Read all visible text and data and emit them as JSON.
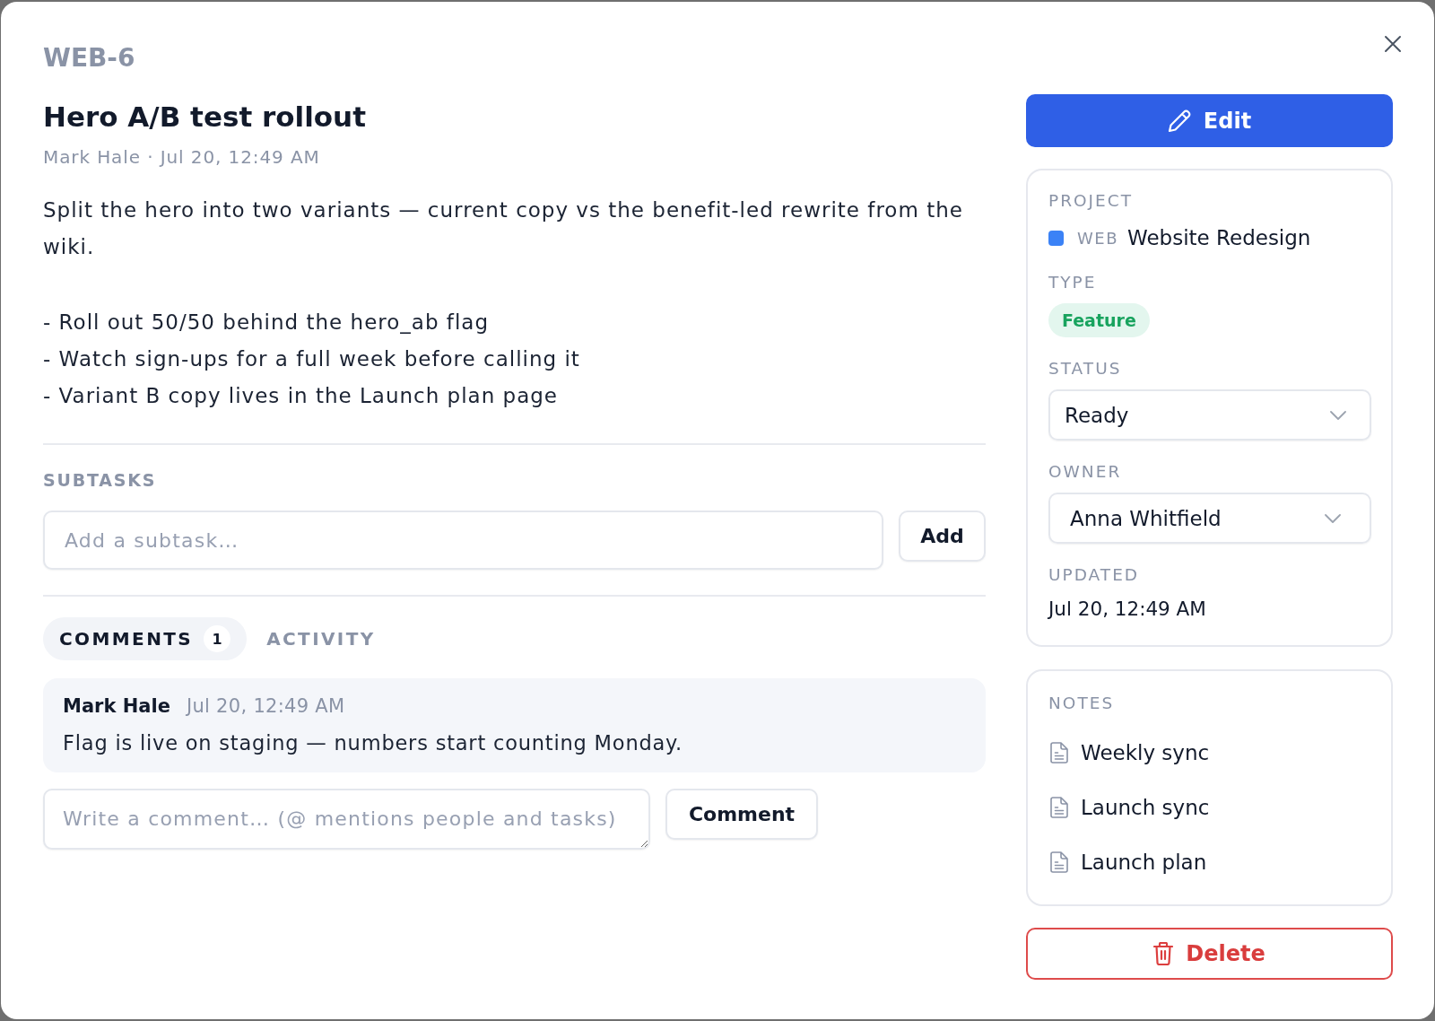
{
  "task": {
    "key": "WEB-6",
    "title": "Hero A/B test rollout",
    "meta": "Mark Hale · Jul 20, 12:49 AM",
    "description": {
      "paragraph": "Split the hero into two variants — current copy vs the benefit-led rewrite from the wiki.",
      "bullets": [
        "- Roll out 50/50 behind the hero_ab flag",
        "- Watch sign-ups for a full week before calling it",
        "- Variant B copy lives in the Launch plan page"
      ]
    }
  },
  "subtasks": {
    "heading": "SUBTASKS",
    "input": {
      "placeholder": "Add a subtask…"
    },
    "add_button": "Add"
  },
  "tabs": [
    {
      "label": "COMMENTS",
      "count": "1",
      "selected": true
    },
    {
      "label": "ACTIVITY",
      "selected": false
    }
  ],
  "comments": [
    {
      "author": "Mark Hale",
      "time": "Jul 20, 12:49 AM",
      "body": "Flag is live on staging — numbers start counting Monday."
    }
  ],
  "composer": {
    "placeholder": "Write a comment… (@ mentions people and tasks)",
    "button": "Comment"
  },
  "sidebar": {
    "edit_button": "Edit",
    "details": {
      "project": {
        "label": "PROJECT",
        "key": "WEB",
        "name": "Website Redesign"
      },
      "type": {
        "label": "TYPE",
        "value": "Feature"
      },
      "status": {
        "label": "STATUS",
        "value": "Ready"
      },
      "owner": {
        "label": "OWNER",
        "value": "Anna Whitfield"
      },
      "updated": {
        "label": "UPDATED",
        "value": "Jul 20, 12:49 AM"
      }
    },
    "notes": {
      "heading": "NOTES",
      "items": [
        "Weekly sync",
        "Launch sync",
        "Launch plan"
      ]
    },
    "delete_button": "Delete"
  }
}
